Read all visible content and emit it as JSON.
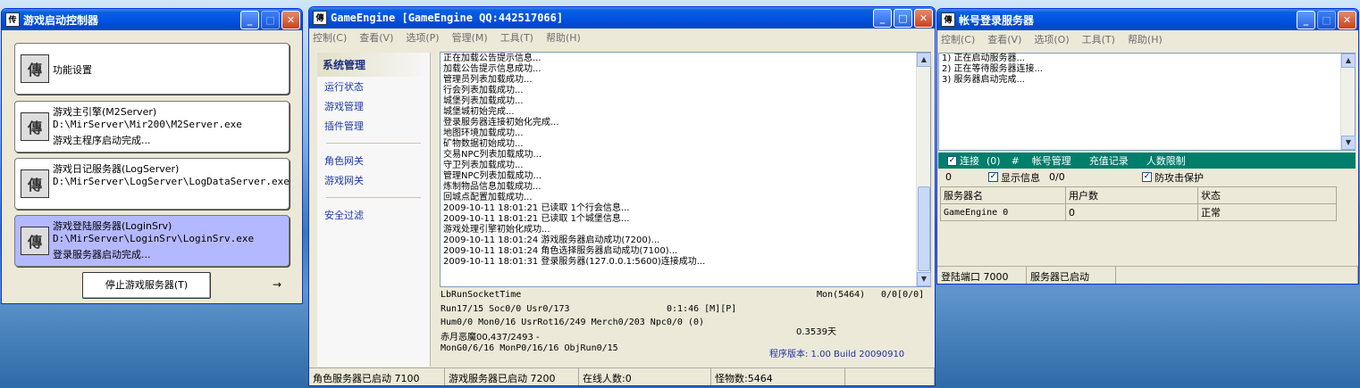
{
  "win1": {
    "title": "游戏启动控制器",
    "cards": [
      {
        "l1": "功能设置",
        "l2": "",
        "l3": ""
      },
      {
        "l1": "游戏主引擎(M2Server)",
        "l2": "D:\\MirServer\\Mir200\\M2Server.exe",
        "l3": "游戏主程序启动完成..."
      },
      {
        "l1": "游戏日记服务器(LogServer)",
        "l2": "D:\\MirServer\\LogServer\\LogDataServer.exe",
        "l3": ""
      },
      {
        "l1": "游戏登陆服务器(LoginSrv)",
        "l2": "D:\\MirServer\\LoginSrv\\LoginSrv.exe",
        "l3": "登录服务器启动完成..."
      }
    ],
    "stop_btn": "停止游戏服务器(T)",
    "arrow": "→"
  },
  "win2": {
    "title": "GameEngine [GameEngine QQ:442517066]",
    "menu": [
      "控制(C)",
      "查看(V)",
      "选项(P)",
      "管理(M)",
      "工具(T)",
      "帮助(H)"
    ],
    "sidebar_head": "系统管理",
    "side_a": [
      "运行状态",
      "游戏管理",
      "插件管理"
    ],
    "side_b": [
      "角色网关",
      "游戏网关"
    ],
    "side_c": [
      "安全过滤"
    ],
    "log": [
      "正在加载公告提示信息...",
      "加载公告提示信息成功...",
      "管理员列表加载成功...",
      "行会列表加载成功...",
      "城堡列表加载成功...",
      "城堡城初始完成...",
      "登录服务器连接初始化完成...",
      "地图环境加载成功...",
      "矿物数据初始成功...",
      "交易NPC列表加载成功...",
      "守卫列表加载成功...",
      "管理NPC列表加载成功...",
      "炼制物品信息加载成功...",
      "回城点配置加载成功...",
      "2009-10-11 18:01:21 已读取 1个行会信息...",
      "2009-10-11 18:01:21 已读取 1个城堡信息...",
      "游戏处理引擎初始化成功...",
      "2009-10-11 18:01:24 游戏服务器启动成功(7200)...",
      "2009-10-11 18:01:24 角色选择服务器启动成功(7100)...",
      "2009-10-11 18:01:31 登录服务器(127.0.0.1:5600)连接成功..."
    ],
    "stats": {
      "socket": "LbRunSocketTime",
      "mon": "Mon(5464)",
      "zero": "0/0[0/0]",
      "run": "Run17/15 Soc0/0 Usr0/173",
      "time": "0:1:46 [M][P]",
      "hum": "Hum0/0 Mon0/16 UsrRot16/249 Merch0/203 Npc0/0 (0)",
      "map": "赤月恶魔00,437/2493 -",
      "days": "0.3539天",
      "mong": "MonG0/6/16 MonP0/16/16 ObjRun0/15",
      "ver": "程序版本: 1.00 Build 20090910"
    },
    "status": [
      "角色服务器已启动 7100",
      "游戏服务器已启动 7200",
      "在线人数:0",
      "怪物数:5464"
    ]
  },
  "win3": {
    "title": "帐号登录服务器",
    "menu": [
      "控制(C)",
      "查看(V)",
      "选项(O)",
      "工具(T)",
      "帮助(H)"
    ],
    "log": [
      "1) 正在启动服务器...",
      "2) 正在等待服务器连接...",
      "3) 服务器启动完成..."
    ],
    "teal": {
      "connect": "连接",
      "count": "(0)",
      "hash": "#",
      "acct": "帐号管理",
      "recharge": "充值记录",
      "limit": "人数限制"
    },
    "row2": {
      "zero": "0",
      "show": "显示信息",
      "ratio": "0/0",
      "protect": "防攻击保护"
    },
    "cols": [
      "服务器名",
      "用户数",
      "状态"
    ],
    "rows": [
      [
        "GameEngine 0",
        "0",
        "正常"
      ]
    ],
    "status": [
      "登陆端口 7000",
      "服务器已启动"
    ]
  }
}
